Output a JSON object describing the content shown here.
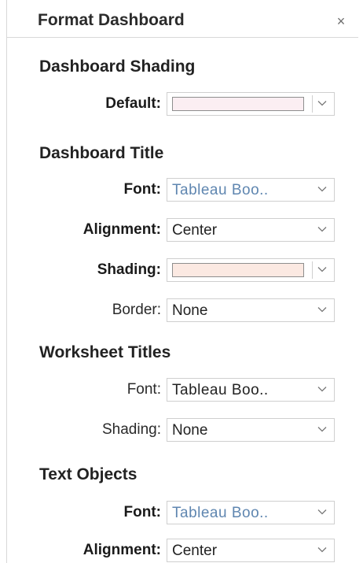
{
  "panel": {
    "title": "Format Dashboard",
    "close_glyph": "×"
  },
  "dashboard_shading": {
    "title": "Dashboard Shading",
    "default_label": "Default:",
    "default_color": "#fbeef2"
  },
  "dashboard_title": {
    "title": "Dashboard Title",
    "font_label": "Font:",
    "font_value": "Tableau Boo..",
    "alignment_label": "Alignment:",
    "alignment_value": "Center",
    "shading_label": "Shading:",
    "shading_color": "#fbe9e2",
    "border_label": "Border:",
    "border_value": "None"
  },
  "worksheet_titles": {
    "title": "Worksheet Titles",
    "font_label": "Font:",
    "font_value": "Tableau Boo..",
    "shading_label": "Shading:",
    "shading_value": "None"
  },
  "text_objects": {
    "title": "Text Objects",
    "font_label": "Font:",
    "font_value": "Tableau Boo..",
    "alignment_label": "Alignment:",
    "alignment_value": "Center"
  },
  "icons": {
    "dropdown": "chevron-down-icon",
    "close": "close-icon"
  },
  "colors": {
    "font_value_blue": "#5f86b0",
    "border": "#cfcfcf"
  }
}
